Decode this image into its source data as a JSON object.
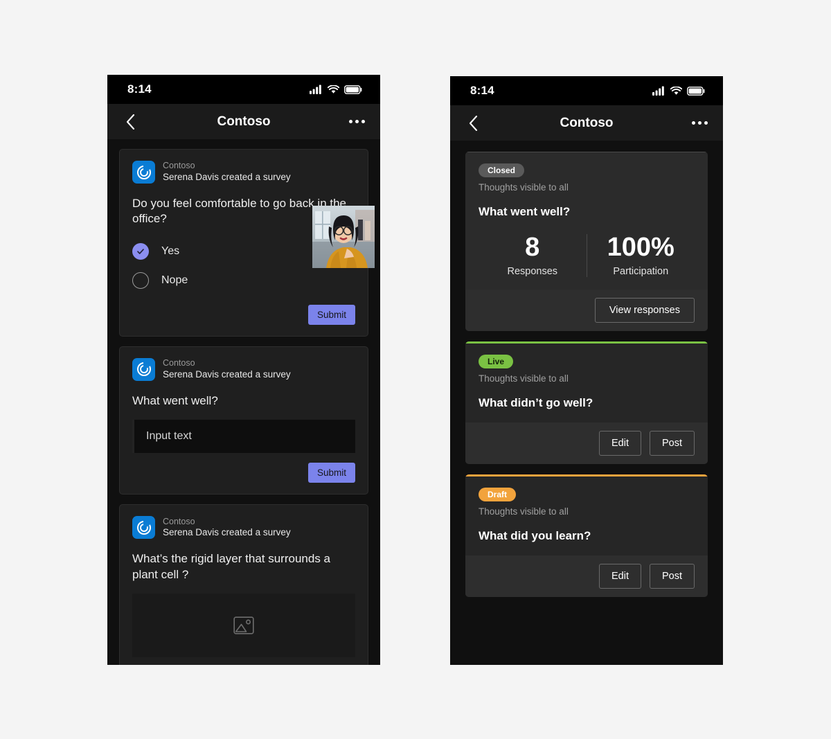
{
  "left_phone": {
    "status_bar": {
      "time": "8:14",
      "icons": [
        "signal-icon",
        "wifi-icon",
        "battery-icon"
      ]
    },
    "nav": {
      "back_icon": "chevron-left-icon",
      "title": "Contoso",
      "more_icon": "more-horizontal-icon"
    },
    "thumbnail": {
      "alt": "portrait of woman with glasses in mustard top"
    },
    "cards": [
      {
        "app_name": "Contoso",
        "subtitle": "Serena Davis created a survey",
        "question": "Do you feel comfortable to go back in the office?",
        "options": [
          {
            "label": "Yes",
            "selected": true
          },
          {
            "label": "Nope",
            "selected": false
          }
        ],
        "submit_label": "Submit"
      },
      {
        "app_name": "Contoso",
        "subtitle": "Serena Davis created a survey",
        "question": "What went well?",
        "input_placeholder": "Input text",
        "submit_label": "Submit"
      },
      {
        "app_name": "Contoso",
        "subtitle": "Serena Davis created a survey",
        "question": "What’s the rigid layer that surrounds a plant cell ?",
        "image_placeholder_icon": "image-placeholder-icon"
      }
    ]
  },
  "right_phone": {
    "status_bar": {
      "time": "8:14",
      "icons": [
        "signal-icon",
        "wifi-icon",
        "battery-icon"
      ]
    },
    "nav": {
      "back_icon": "chevron-left-icon",
      "title": "Contoso",
      "more_icon": "more-horizontal-icon"
    },
    "cards": [
      {
        "status": "Closed",
        "visibility": "Thoughts visible to all",
        "title": "What went well?",
        "stats": [
          {
            "value": "8",
            "label": "Responses"
          },
          {
            "value": "100%",
            "label": "Participation"
          }
        ],
        "actions": [
          "View responses"
        ]
      },
      {
        "status": "Live",
        "visibility": "Thoughts visible to all",
        "title": "What didn’t go well?",
        "actions": [
          "Edit",
          "Post"
        ]
      },
      {
        "status": "Draft",
        "visibility": "Thoughts visible to all",
        "title": "What did you learn?",
        "actions": [
          "Edit",
          "Post"
        ]
      }
    ]
  },
  "colors": {
    "page_background": "#f4f4f4",
    "phone_background": "#101010",
    "card_background": "#1f1f1f",
    "accent_purple": "#7b83eb",
    "brand_blue": "#0a7cd4",
    "status_live_green": "#7ac143",
    "status_draft_orange": "#f2a33c",
    "status_closed_gray": "#5a5a5a"
  }
}
